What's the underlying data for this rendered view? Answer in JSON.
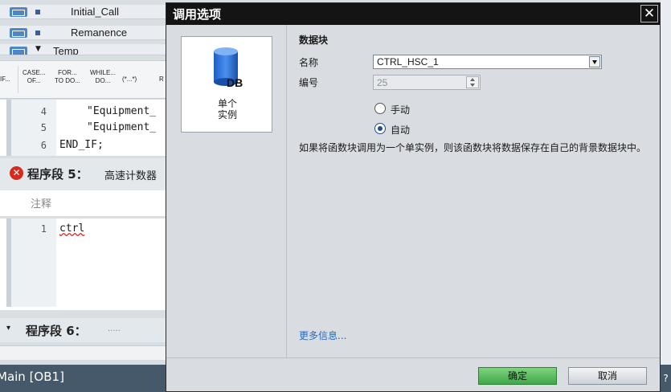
{
  "background": {
    "interface_rows": [
      "Initial_Call",
      "Remanence",
      "Temp"
    ],
    "keywords": [
      "IF...",
      "CASE...\nOF...",
      "FOR...\nTO DO...",
      "WHILE...\nDO...",
      "(*...*)",
      "R"
    ],
    "code_top": {
      "line_numbers": [
        "4",
        "5",
        "6"
      ],
      "lines": [
        "\"Equipment_",
        "\"Equipment_",
        "END_IF;"
      ]
    },
    "segment5": {
      "title": "程序段 5：",
      "name": "高速计数器"
    },
    "comment_label": "注释",
    "code_bottom": {
      "line_numbers": [
        "1"
      ],
      "lines": [
        "ctrl"
      ]
    },
    "segment6": {
      "title": "程序段 6：",
      "name": "....."
    },
    "status_text": "Main [OB1]",
    "right_strip_glyph": "?"
  },
  "dialog": {
    "title": "调用选项",
    "close_glyph": "✕",
    "instance_card": {
      "icon_text": "DB",
      "label": "单个\n实例"
    },
    "section_title": "数据块",
    "name_label": "名称",
    "name_value": "CTRL_HSC_1",
    "number_label": "编号",
    "number_value": "25",
    "radio_manual": "手动",
    "radio_auto": "自动",
    "description": "如果将函数块调用为一个单实例，则该函数块将数据保存在自己的背景数据块中。",
    "more_info": "更多信息...",
    "ok_label": "确定",
    "cancel_label": "取消",
    "colors": {
      "ok_green": "#3fa84a",
      "titlebar": "#141414",
      "link": "#2a6ac0"
    }
  }
}
